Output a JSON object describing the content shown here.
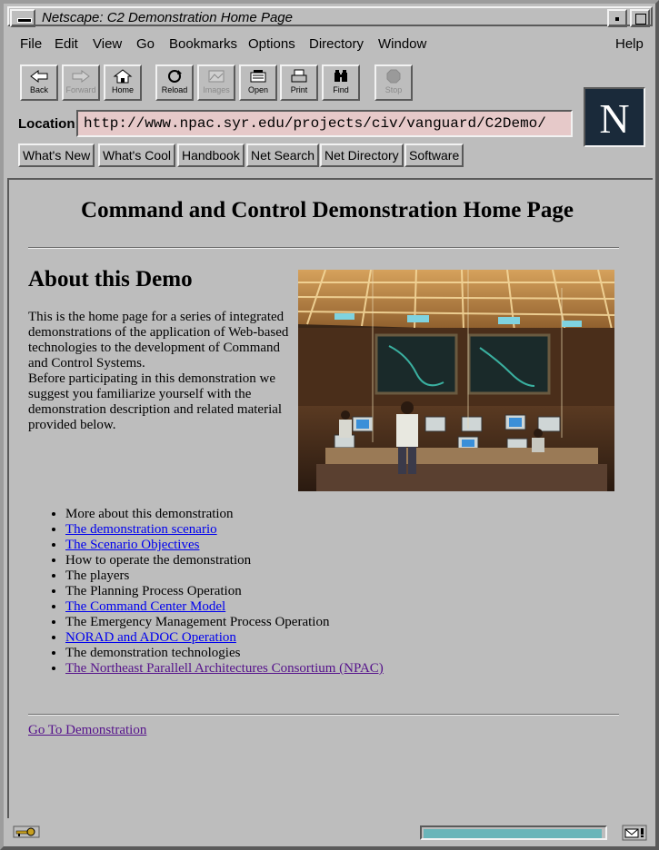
{
  "window": {
    "title": "Netscape: C2 Demonstration Home Page"
  },
  "menu": [
    "File",
    "Edit",
    "View",
    "Go",
    "Bookmarks",
    "Options",
    "Directory",
    "Window",
    "Help"
  ],
  "toolbar": {
    "back": "Back",
    "forward": "Forward",
    "home": "Home",
    "reload": "Reload",
    "images": "Images",
    "open": "Open",
    "print": "Print",
    "find": "Find",
    "stop": "Stop"
  },
  "location": {
    "label": "Location:",
    "url": "http://www.npac.syr.edu/projects/civ/vanguard/C2Demo/"
  },
  "directory_buttons": [
    "What's New",
    "What's Cool",
    "Handbook",
    "Net Search",
    "Net Directory",
    "Software"
  ],
  "logo_letter": "N",
  "page": {
    "title": "Command and Control Demonstration Home Page",
    "about_heading": "About this Demo",
    "intro_p1": "This is the home page for a series of integrated demonstrations of the application of Web-based technologies to the development of Command and Control Systems.",
    "intro_p2": "Before participating in this demonstration we suggest you familiarize yourself with the demonstration description and related material provided below.",
    "list": [
      {
        "text": "More about this demonstration",
        "link": false,
        "visited": false
      },
      {
        "text": "The demonstration scenario",
        "link": true,
        "visited": false
      },
      {
        "text": "The Scenario Objectives",
        "link": true,
        "visited": false
      },
      {
        "text": "How to operate the demonstration",
        "link": false,
        "visited": false
      },
      {
        "text": "The players",
        "link": false,
        "visited": false
      },
      {
        "text": "The Planning Process Operation",
        "link": false,
        "visited": false
      },
      {
        "text": "The Command Center Model",
        "link": true,
        "visited": false
      },
      {
        "text": "The Emergency Management Process Operation",
        "link": false,
        "visited": false
      },
      {
        "text": "NORAD and ADOC Operation",
        "link": true,
        "visited": false
      },
      {
        "text": "The demonstration technologies",
        "link": false,
        "visited": false
      },
      {
        "text": "The Northeast Parallell Architectures Consortium (NPAC)",
        "link": true,
        "visited": true
      }
    ],
    "go_demo": "Go To Demonstration"
  },
  "status": {
    "progress_fraction": 0.99
  },
  "colors": {
    "link": "#0000ee",
    "visited": "#55128b",
    "location_bg": "#e6c9c9",
    "progress": "#6ab5b9",
    "chrome": "#bdbdbd"
  },
  "icons": [
    "back-arrow-icon",
    "forward-arrow-icon",
    "home-icon",
    "reload-icon",
    "images-icon",
    "open-icon",
    "print-icon",
    "find-icon",
    "stop-icon",
    "security-key-icon",
    "mail-icon"
  ]
}
